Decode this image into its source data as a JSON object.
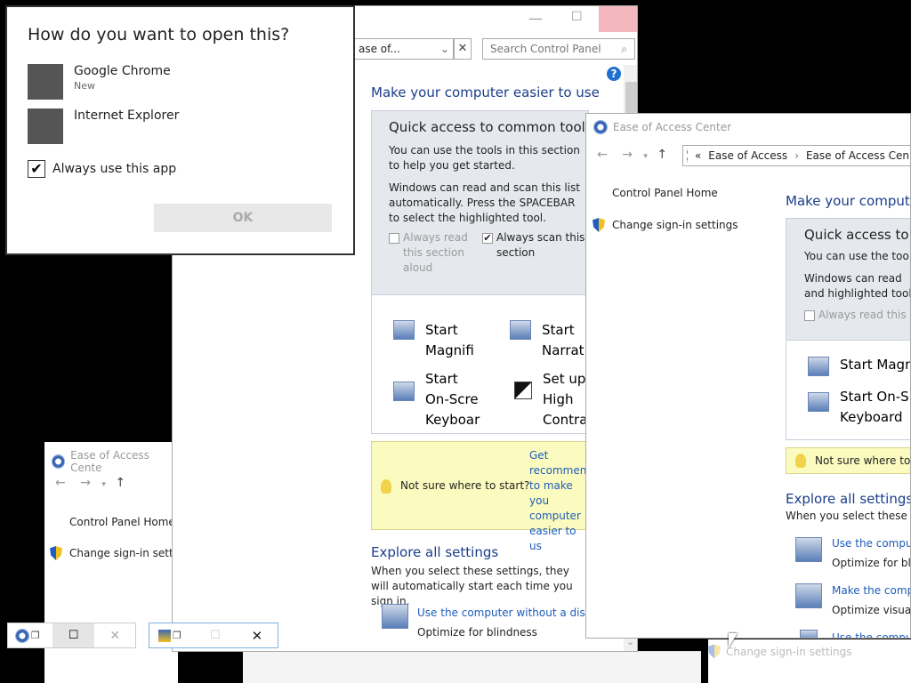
{
  "dialog": {
    "title": "How do you want to open this?",
    "apps": [
      {
        "name": "Google Chrome",
        "sub": "New"
      },
      {
        "name": "Internet Explorer",
        "sub": ""
      }
    ],
    "always_label": "Always use this app",
    "ok_label": "OK"
  },
  "main_window": {
    "address_crumb": "ase of...",
    "search_placeholder": "Search Control Panel",
    "help_icon": "?",
    "heading": "Make your computer easier to use",
    "quick_title": "Quick access to common tools",
    "quick_text1": "You can use the tools in this section to help you get started.",
    "quick_text2": "Windows can read and scan this list automatically.  Press the SPACEBAR to select the highlighted tool.",
    "always_read": "Always read this section aloud",
    "always_scan": "Always scan this section",
    "tools": [
      {
        "label": "Start Magnifi"
      },
      {
        "label": "Start Narrat"
      },
      {
        "label": "Start On-Scre Keyboar"
      },
      {
        "label": "Set up High Contra"
      }
    ],
    "not_sure": "Not sure where to start?",
    "get_recommend": "Get recommenda to make you computer easier to us",
    "explore_title": "Explore all settings",
    "explore_text": "When you select these settings, they will automatically start each time you sign in.",
    "use_without_display": "Use the computer without a displa",
    "optimize_blind": "Optimize for blindness"
  },
  "right_window": {
    "title": "Ease of Access Center",
    "crumb1": "Ease of Access",
    "crumb2": "Ease of Access Cen",
    "cp_home": "Control Panel Home",
    "change_signin": "Change sign-in settings",
    "heading": "Make your compute",
    "quick_title": "Quick access to",
    "quick_text1": "You can use the tools",
    "quick_text2": "Windows can read and highlighted tool.",
    "always_read": "Always read this se",
    "tool1": "Start Magn",
    "tool2": "Start On-S Keyboard",
    "not_sure": "Not sure where to s",
    "explore_title": "Explore all settings",
    "explore_text": "When you select these set",
    "item1": "Use the compute",
    "item1_sub": "Optimize for bli",
    "item2": "Make the comput",
    "item2_sub": "Optimize visual",
    "item3": "Use the comput"
  },
  "bottom_window": {
    "title": "Ease of Access Cente",
    "cp_home": "Control Panel Home",
    "change_signin": "Change sign-in setting",
    "bottom_change": "Change sign-in settings"
  },
  "taskbar_thumbs": {
    "maximize": "☐",
    "close": "✕"
  }
}
